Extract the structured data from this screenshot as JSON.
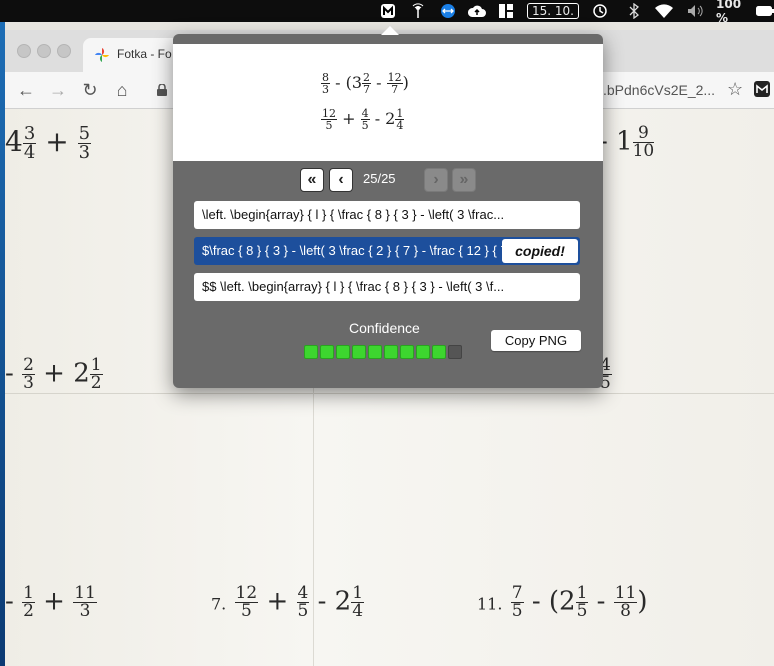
{
  "menubar": {
    "date": "15. 10.",
    "battery": "100 %"
  },
  "browser": {
    "tab_title": "Fotka - Fo",
    "url_tail": ".bPdn6cVs2E_2..."
  },
  "page_math": {
    "row1_left_whole": "4",
    "row1_left_f1": {
      "n": "3",
      "d": "4"
    },
    "row1_left_op": "+",
    "row1_left_f2": {
      "n": "5",
      "d": "3"
    },
    "row1_right_prefix": "- 1",
    "row1_right_f": {
      "n": "9",
      "d": "10"
    },
    "row2_left_f1": {
      "n": "2",
      "d": "3"
    },
    "row2_left_op": "+ 2",
    "row2_left_f2": {
      "n": "1",
      "d": "2"
    },
    "row2_right_f": {
      "n": "4",
      "d": "5"
    },
    "row3_left_f1": {
      "n": "1",
      "d": "2"
    },
    "row3_left_op": "+",
    "row3_left_f2": {
      "n": "11",
      "d": "3"
    },
    "row3_mid_label": "7.",
    "row3_mid_f1": {
      "n": "12",
      "d": "5"
    },
    "row3_mid_op1": "+",
    "row3_mid_f2": {
      "n": "4",
      "d": "5"
    },
    "row3_mid_op2": "- 2",
    "row3_mid_f3": {
      "n": "1",
      "d": "4"
    },
    "row3_right_label": "11.",
    "row3_right_f1": {
      "n": "7",
      "d": "5"
    },
    "row3_right_op": "- (2",
    "row3_right_f2": {
      "n": "1",
      "d": "5"
    },
    "row3_right_op2": "-",
    "row3_right_f3": {
      "n": "11",
      "d": "8"
    },
    "row3_right_close": ")"
  },
  "popover": {
    "preview": {
      "l1_f1": {
        "n": "8",
        "d": "3"
      },
      "l1_op": "- (3",
      "l1_f2": {
        "n": "2",
        "d": "7"
      },
      "l1_op2": "-",
      "l1_f3": {
        "n": "12",
        "d": "7"
      },
      "l1_close": ")",
      "l2_f1": {
        "n": "12",
        "d": "5"
      },
      "l2_op": "+",
      "l2_f2": {
        "n": "4",
        "d": "5"
      },
      "l2_op2": "- 2",
      "l2_f3": {
        "n": "1",
        "d": "4"
      }
    },
    "counter": "25/25",
    "results": [
      "\\left. \\begin{array} { l } { \\frac { 8 } { 3 } - \\left( 3 \\frac...",
      "$\\frac { 8 } { 3 } - \\left( 3 \\frac { 2 } { 7 } - \\frac { 12 } { 7 }",
      "$$ \\left. \\begin{array} { l } { \\frac { 8 } { 3 } - \\left( 3 \\f..."
    ],
    "copied_label": "copied!",
    "confidence_label": "Confidence",
    "confidence_level": 0.9,
    "confidence_segments": 10,
    "copy_png_label": "Copy PNG"
  }
}
